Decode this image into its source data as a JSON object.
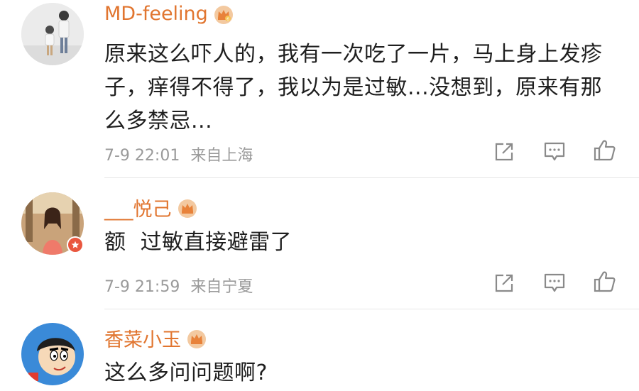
{
  "comments": [
    {
      "username": "MD-feeling",
      "text": "原来这么吓人的，我有一次吃了一片，马上身上发疹子，痒得不得了，我以为是过敏...没想到，原来有那么多禁忌...",
      "time": "7-9 22:01",
      "location": "来自上海"
    },
    {
      "username": "___悦己",
      "text": "额  过敏直接避雷了",
      "time": "7-9 21:59",
      "location": "来自宁夏"
    },
    {
      "username": "香菜小玉",
      "text": "这么多问问题啊?"
    }
  ],
  "icons": {
    "share": "share-icon",
    "comment": "comment-icon",
    "like": "like-icon",
    "crown": "crown-icon"
  },
  "colors": {
    "username": "#e1752f",
    "meta": "#9a9a9a",
    "text": "#1f1f1f",
    "icon": "#8a8a8a"
  }
}
